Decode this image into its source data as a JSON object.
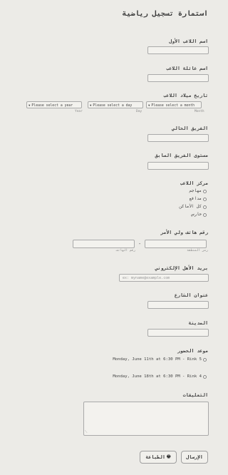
{
  "form": {
    "title": "استمارة تسجيل رياضية",
    "first_name": {
      "label": "اسم اللاعب الأول",
      "value": ""
    },
    "last_name": {
      "label": "اسم عائلة اللاعب",
      "value": ""
    },
    "birth_date": {
      "label": "تاريخ ميلاد اللاعب",
      "month_placeholder": "Please select a month",
      "day_placeholder": "Please select a day",
      "year_placeholder": "Please select a year",
      "month_sublabel": "Month",
      "day_sublabel": "Day",
      "year_sublabel": "Year"
    },
    "current_team": {
      "label": "الفريق الحالي",
      "value": ""
    },
    "previous_level": {
      "label": "مستوى الفريق السابق",
      "value": ""
    },
    "position": {
      "label": "مركز اللاعب",
      "options": [
        "مهاجم",
        "مدافع",
        "كل الأماكن",
        "حارس"
      ]
    },
    "parent_phone": {
      "label": "رقم هاتف ولي الأمر",
      "area_sublabel": "رمز المنطقة",
      "number_sublabel": "رقم الهاتف"
    },
    "parent_email": {
      "label": "بريد الأهل الإلكتروني",
      "placeholder": "ex: myname@example.com"
    },
    "street": {
      "label": "عنوان الشارع",
      "value": ""
    },
    "city": {
      "label": "المدينة",
      "value": ""
    },
    "tryout": {
      "label": "موعد الحضور",
      "options": [
        "Monday, June 11th at 6:30 PM - Rink 5",
        "Monday, June 18th at 6:30 PM - Rink 4"
      ]
    },
    "comments": {
      "label": "التعليقات",
      "value": ""
    },
    "submit_label": "الإرسال",
    "print_label": "الطباعة"
  },
  "icons": {
    "printer": "printer-icon",
    "dropdown": "chevron-down-icon"
  },
  "colors": {
    "background": "#ecebe7",
    "border": "#a9a9a9",
    "text": "#3b3b3b"
  }
}
